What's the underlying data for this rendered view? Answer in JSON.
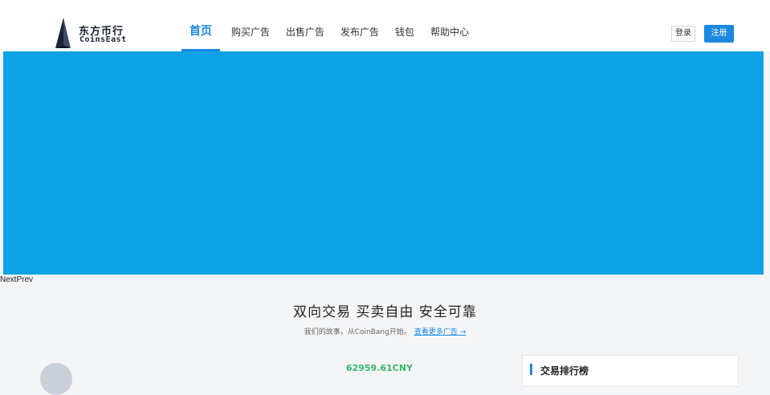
{
  "header": {
    "logo": {
      "cn": "东方币行",
      "en": "CoinsEast"
    },
    "nav": [
      {
        "label": "首页",
        "active": true
      },
      {
        "label": "购买广告",
        "active": false
      },
      {
        "label": "出售广告",
        "active": false
      },
      {
        "label": "发布广告",
        "active": false
      },
      {
        "label": "钱包",
        "active": false
      },
      {
        "label": "帮助中心",
        "active": false
      }
    ],
    "login_label": "登录",
    "register_label": "注册"
  },
  "banner": {
    "color": "#10a2e6"
  },
  "slider": {
    "next_label": "Next",
    "prev_label": "Prev"
  },
  "intro": {
    "headline": "双向交易 买卖自由 安全可靠",
    "subline": "我们的故事，从CoinBang开始。",
    "link_label": "查看更多广告 →"
  },
  "stats": {
    "price": "62959.61CNY"
  },
  "ranking": {
    "title": "交易排行榜"
  },
  "colors": {
    "accent": "#1b88e3",
    "price": "#35b86b"
  }
}
